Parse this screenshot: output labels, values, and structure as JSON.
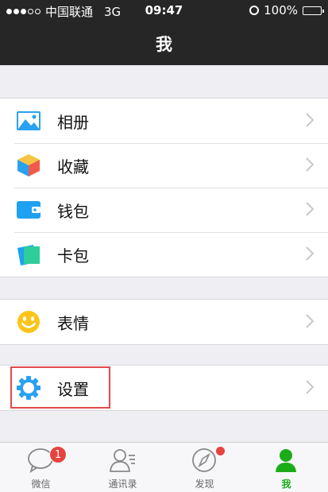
{
  "status_bar": {
    "carrier": "中国联通",
    "network": "3G",
    "time": "09:47",
    "battery": "100%"
  },
  "nav": {
    "title": "我"
  },
  "menu_groups": [
    {
      "items": [
        {
          "label": "相册",
          "icon": "photo-album-icon"
        },
        {
          "label": "收藏",
          "icon": "favorites-cube-icon"
        },
        {
          "label": "钱包",
          "icon": "wallet-icon"
        },
        {
          "label": "卡包",
          "icon": "card-holder-icon"
        }
      ]
    },
    {
      "items": [
        {
          "label": "表情",
          "icon": "emoji-smile-icon"
        }
      ]
    },
    {
      "items": [
        {
          "label": "设置",
          "icon": "settings-gear-icon"
        }
      ]
    }
  ],
  "tab_bar": {
    "tabs": [
      {
        "label": "微信",
        "icon": "chat-bubble-icon",
        "badge": "1"
      },
      {
        "label": "通讯录",
        "icon": "contacts-icon"
      },
      {
        "label": "发现",
        "icon": "compass-icon"
      },
      {
        "label": "我",
        "icon": "me-person-icon",
        "active": true
      }
    ]
  },
  "colors": {
    "header_bg": "#262626",
    "accent_green": "#1aad19",
    "badge_red": "#e64340",
    "highlight_red": "#e34a4a"
  }
}
